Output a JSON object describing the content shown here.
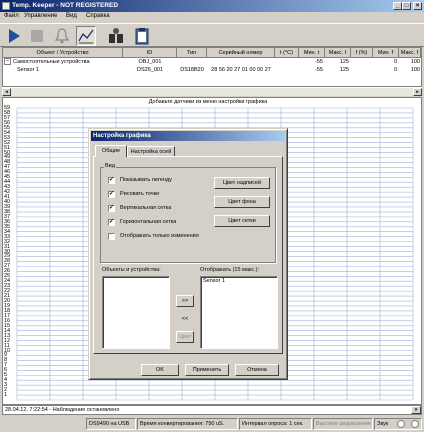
{
  "window": {
    "title": "Temp. Keeper - NOT REGISTERED"
  },
  "menu": [
    "Файл",
    "Управление",
    "Вид",
    "Справка"
  ],
  "toolbar": {
    "tools": [
      {
        "name": "play-icon"
      },
      {
        "name": "stop-icon"
      },
      {
        "name": "bell-icon"
      },
      {
        "name": "chart-icon"
      },
      {
        "name": "devices-icon"
      },
      {
        "name": "clipboard-icon"
      }
    ]
  },
  "table": {
    "headers": [
      "Объект / Устройство",
      "ID",
      "Тип",
      "Серийный номер",
      "t (°C)",
      "Мин. t",
      "Макс. t",
      "f (%)",
      "Мин. f",
      "Макс. f"
    ],
    "rows": [
      {
        "expander": "−",
        "name": "Самостоятельные устройства",
        "id": "OBJ_001",
        "type": "",
        "serial": "",
        "t": "",
        "tmin": "-55",
        "tmax": "125",
        "f": "",
        "fmin": "0",
        "fmax": "100"
      },
      {
        "expander": "",
        "name": "Sensor 1",
        "id": "DS26_001",
        "type": "DS18B20",
        "serial": "28 56 20 27 01 00 00 27",
        "t": "",
        "tmin": "-55",
        "tmax": "125",
        "f": "",
        "fmin": "0",
        "fmax": "100"
      }
    ]
  },
  "chart": {
    "hint": "Добавьте датчики из меню настройки графика",
    "yticks": [
      "59",
      "57",
      "55",
      "53",
      "51",
      "49",
      "47",
      "45",
      "43",
      "41",
      "39",
      "37",
      "35",
      "33",
      "31",
      "29",
      "27",
      "25",
      "23",
      "21",
      "19",
      "17",
      "15",
      "13",
      "11",
      "9",
      "7",
      "5",
      "3",
      "1"
    ],
    "ytick_alt": [
      "58",
      "56",
      "54",
      "52",
      "50",
      "48",
      "46",
      "44",
      "42",
      "40",
      "38",
      "36",
      "34",
      "32",
      "30",
      "28",
      "26",
      "24",
      "22",
      "20",
      "18",
      "16",
      "14",
      "12",
      "10",
      "8",
      "6",
      "4",
      "2"
    ]
  },
  "chart_data": {
    "type": "line",
    "title": "Добавьте датчики из меню настройки графика",
    "ylim": [
      0,
      59
    ],
    "series": [],
    "grid": true
  },
  "log": {
    "message": "28.04.12, 7:22:54 - Наблюдение остановлено"
  },
  "statusbar": {
    "usb": "DS9490 на USB",
    "conv": "Время конвертирования: 750 uS.",
    "poll": "Интервал опроса: 1 сек.",
    "hires": "Высокое разрешение",
    "sound": "Звук"
  },
  "dialog": {
    "title": "Настройка графика",
    "tabs": [
      "Общие",
      "Настройка осей"
    ],
    "view_group": "Вид",
    "checks": [
      {
        "label": "Показывать легенду",
        "checked": true
      },
      {
        "label": "Рисовать точки",
        "checked": true
      },
      {
        "label": "Вертикальная сетка",
        "checked": true
      },
      {
        "label": "Горизонтальная сетка",
        "checked": true
      },
      {
        "label": "Отображать только изменения",
        "checked": false
      }
    ],
    "color_buttons": [
      "Цвет надписей",
      "Цвет фона",
      "Цвет сетки"
    ],
    "objects_label": "Объекты и устройства:",
    "display_label": "Отображать  (15 макс.):",
    "display_items": [
      "Sensor 1"
    ],
    "move_right": ">>",
    "move_left": "<<",
    "color_btn": "Цвет",
    "ok": "OK",
    "apply": "Применить",
    "cancel": "Отмена",
    "check_mark": "✓"
  }
}
